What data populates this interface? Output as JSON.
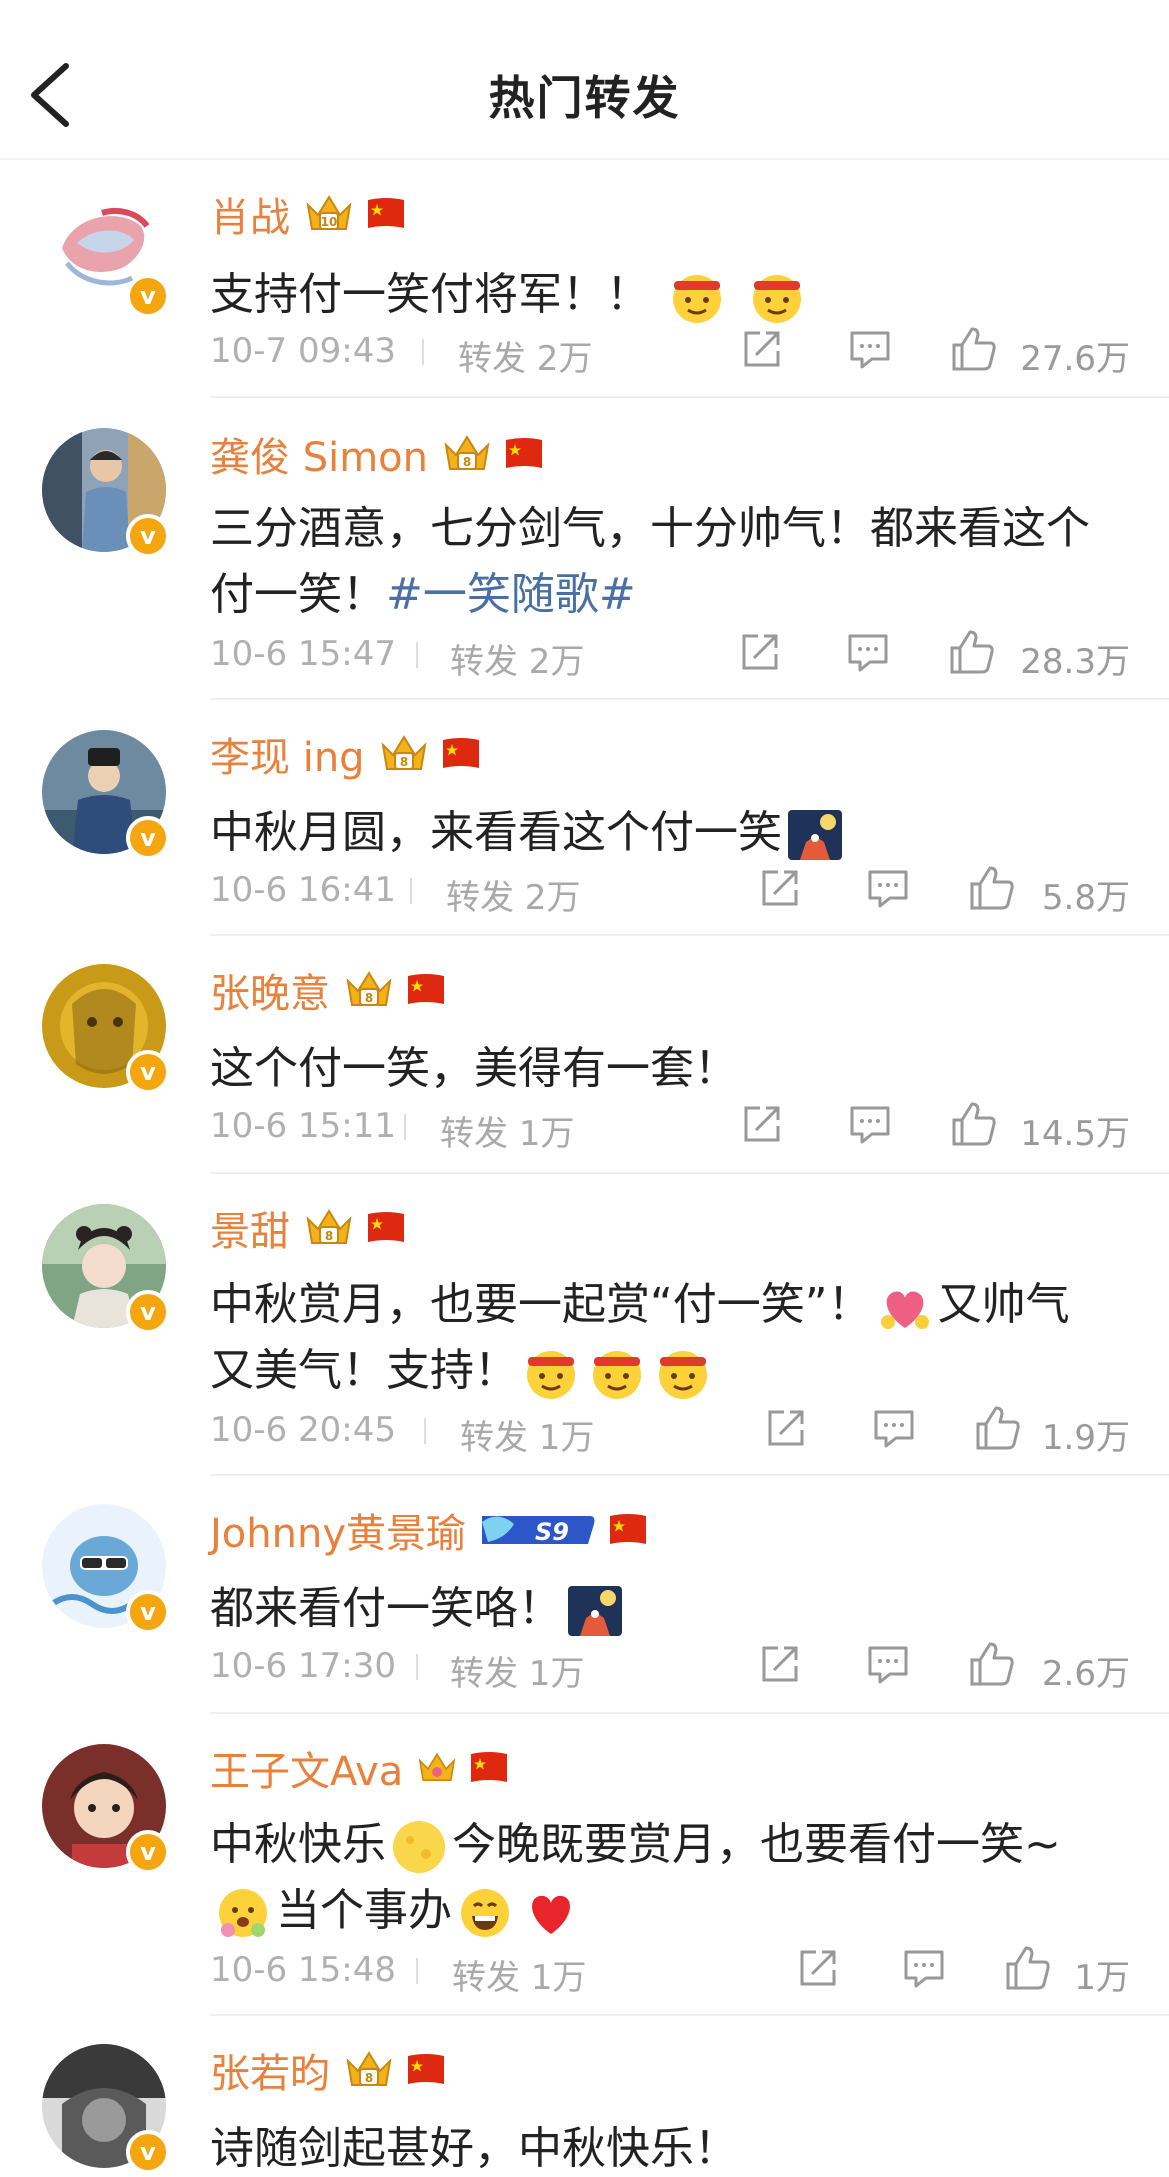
{
  "header": {
    "title": "热门转发"
  },
  "posts": [
    {
      "username": "肖战",
      "content": [
        "支持付一笑付将军！！ "
      ],
      "emojis": [
        "headband-smile-emoji",
        "headband-smile-emoji"
      ],
      "time": "10-7 09:43",
      "repost_label": "转发 2万",
      "likes": "27.6万"
    },
    {
      "username": "龚俊 Simon",
      "content_line1": "三分酒意，七分剑气，十分帅气！都来看这个",
      "content_line2_text": "付一笑！",
      "topic": "#一笑随歌#",
      "time": "10-6 15:47",
      "repost_label": "转发 2万",
      "likes": "28.3万"
    },
    {
      "username": "李现 ing",
      "content": "中秋月圆，来看看这个付一笑",
      "time": "10-6 16:41",
      "repost_label": "转发 2万",
      "likes": "5.8万"
    },
    {
      "username": "张晚意",
      "content": "这个付一笑，美得有一套！",
      "time": "10-6 15:11",
      "repost_label": "转发 1万",
      "likes": "14.5万"
    },
    {
      "username": "景甜",
      "content_line1": "中秋赏月，也要一起赏“付一笑”！",
      "content_line1_tail": "又帅气",
      "content_line2": "又美气！支持！",
      "time": "10-6 20:45",
      "repost_label": "转发 1万",
      "likes": "1.9万"
    },
    {
      "username": "Johnny黄景瑜",
      "badge": "S9",
      "content": "都来看付一笑咯！",
      "time": "10-6 17:30",
      "repost_label": "转发 1万",
      "likes": "2.6万"
    },
    {
      "username": "王子文Ava",
      "content_line1_a": "中秋快乐",
      "content_line1_b": "今晚既要赏月，也要看付一笑~",
      "content_line2": "当个事办",
      "time": "10-6 15:48",
      "repost_label": "转发 1万",
      "likes": "1万"
    },
    {
      "username": "张若昀",
      "content": "诗随剑起甚好，中秋快乐！"
    }
  ],
  "icons": {
    "back": "chevron-left-icon",
    "share": "share-icon",
    "comment": "comment-icon",
    "like": "thumbs-up-icon",
    "verified": "verified-v-icon",
    "crown": "crown-badge-icon",
    "flag": "china-flag-icon"
  },
  "colors": {
    "username": "#e8813b",
    "topic": "#4a6fa5",
    "meta": "#b0b0b0",
    "verified": "#f5a60f"
  }
}
